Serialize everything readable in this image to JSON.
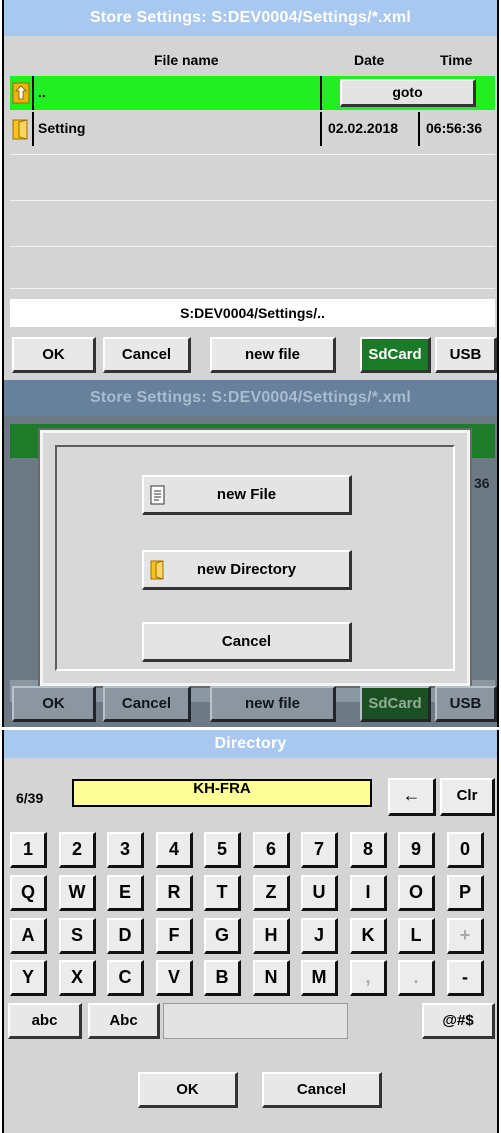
{
  "store_dialog": {
    "title": "Store Settings:  S:DEV0004/Settings/*.xml",
    "columns": {
      "name": "File name",
      "date": "Date",
      "time": "Time"
    },
    "rows": [
      {
        "icon": "up-arrow-icon",
        "name": "..",
        "action": "goto",
        "selected": true
      },
      {
        "icon": "folder-icon",
        "name": "Setting",
        "date": "02.02.2018",
        "time": "06:56:36",
        "selected": false
      }
    ],
    "path": "S:DEV0004/Settings/..",
    "buttons": {
      "ok": "OK",
      "cancel": "Cancel",
      "new_file": "new file",
      "sdcard": "SdCard",
      "usb": "USB"
    },
    "colors": {
      "title_bg": "#a9c8ef",
      "selected_row": "#22ee22",
      "sdcard_active": "#1a7a28"
    }
  },
  "new_dialog": {
    "title": "Store Settings:  S:DEV0004/Settings/*.xml",
    "partial_time": "36",
    "options": {
      "new_file": "new File",
      "new_directory": "new Directory",
      "cancel": "Cancel"
    },
    "buttons": {
      "ok": "OK",
      "cancel": "Cancel",
      "new_file": "new file",
      "sdcard": "SdCard",
      "usb": "USB"
    }
  },
  "keyboard_dialog": {
    "title": "Directory",
    "counter": "6/39",
    "input_value": "KH-FRA",
    "backspace": "←",
    "clear": "Clr",
    "rows": [
      [
        "1",
        "2",
        "3",
        "4",
        "5",
        "6",
        "7",
        "8",
        "9",
        "0"
      ],
      [
        "Q",
        "W",
        "E",
        "R",
        "T",
        "Z",
        "U",
        "I",
        "O",
        "P"
      ],
      [
        "A",
        "S",
        "D",
        "F",
        "G",
        "H",
        "J",
        "K",
        "L",
        "+"
      ],
      [
        "Y",
        "X",
        "C",
        "V",
        "B",
        "N",
        "M",
        ",",
        ".",
        "-"
      ]
    ],
    "disabled_keys": [
      "+",
      ",",
      "."
    ],
    "mode_lower": "abc",
    "mode_shift": "Abc",
    "symbols": "@#$",
    "ok": "OK",
    "cancel": "Cancel",
    "colors": {
      "input_bg": "#ffff99"
    }
  }
}
